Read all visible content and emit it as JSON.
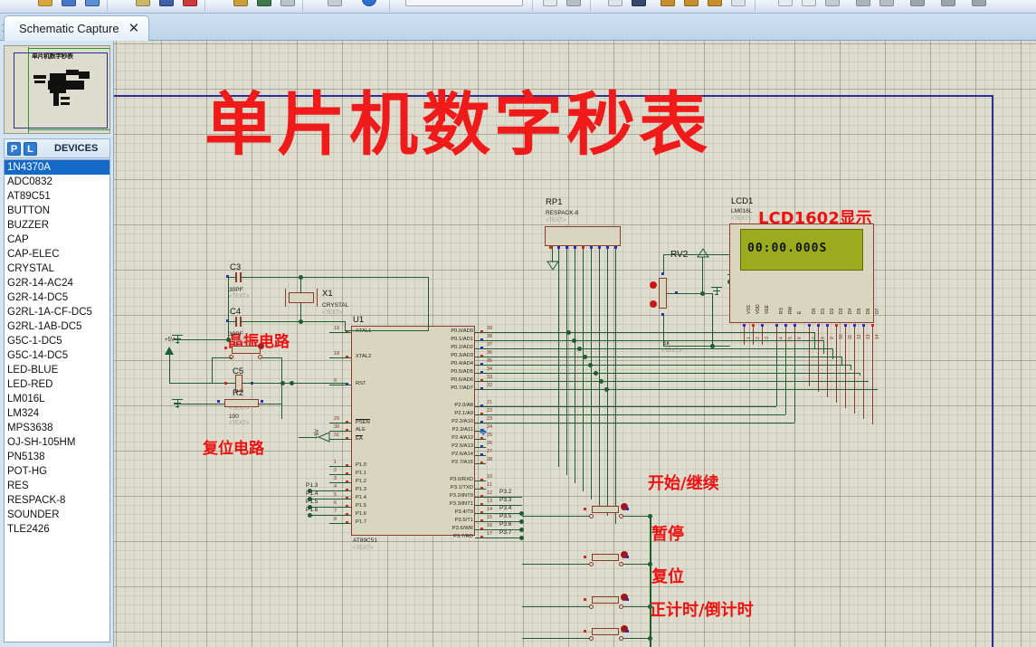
{
  "window": {
    "tab": {
      "label": "Schematic Capture",
      "close_icon": "close-icon",
      "add_icon": "add-tab-icon"
    }
  },
  "left_panel": {
    "navigator": {
      "thumb_title": "单片机数字秒表"
    },
    "devices_bar": {
      "btn_p": "P",
      "btn_l": "L",
      "label": "DEVICES"
    },
    "devices": [
      {
        "name": "1N4370A",
        "selected": true
      },
      {
        "name": "ADC0832",
        "selected": false
      },
      {
        "name": "AT89C51",
        "selected": false
      },
      {
        "name": "BUTTON",
        "selected": false
      },
      {
        "name": "BUZZER",
        "selected": false
      },
      {
        "name": "CAP",
        "selected": false
      },
      {
        "name": "CAP-ELEC",
        "selected": false
      },
      {
        "name": "CRYSTAL",
        "selected": false
      },
      {
        "name": "G2R-14-AC24",
        "selected": false
      },
      {
        "name": "G2R-14-DC5",
        "selected": false
      },
      {
        "name": "G2RL-1A-CF-DC5",
        "selected": false
      },
      {
        "name": "G2RL-1AB-DC5",
        "selected": false
      },
      {
        "name": "G5C-1-DC5",
        "selected": false
      },
      {
        "name": "G5C-14-DC5",
        "selected": false
      },
      {
        "name": "LED-BLUE",
        "selected": false
      },
      {
        "name": "LED-RED",
        "selected": false
      },
      {
        "name": "LM016L",
        "selected": false
      },
      {
        "name": "LM324",
        "selected": false
      },
      {
        "name": "MPS3638",
        "selected": false
      },
      {
        "name": "OJ-SH-105HM",
        "selected": false
      },
      {
        "name": "PN5138",
        "selected": false
      },
      {
        "name": "POT-HG",
        "selected": false
      },
      {
        "name": "RES",
        "selected": false
      },
      {
        "name": "RESPACK-8",
        "selected": false
      },
      {
        "name": "SOUNDER",
        "selected": false
      },
      {
        "name": "TLE2426",
        "selected": false
      }
    ]
  },
  "schematic": {
    "title": "单片机数字秒表",
    "annotations": {
      "lcd": "LCD1602显示",
      "crystal": "晶振电路",
      "reset": "复位电路",
      "btn_start": "开始/继续",
      "btn_pause": "暂停",
      "btn_reset": "复位",
      "btn_dir": "正计时/倒计时"
    },
    "lcd": {
      "ref": "LCD1",
      "value": "LM016L",
      "text_tag": "<TEXT>",
      "display": "00:00.000S",
      "pins": [
        "VSS",
        "VDD",
        "VEE",
        "RS",
        "RW",
        "E",
        "D0",
        "D1",
        "D2",
        "D3",
        "D4",
        "D5",
        "D6",
        "D7"
      ],
      "pin_numbers": [
        "1",
        "2",
        "3",
        "4",
        "5",
        "6",
        "7",
        "8",
        "9",
        "10",
        "11",
        "12",
        "13",
        "14"
      ]
    },
    "mcu": {
      "ref": "U1",
      "value": "AT89C51",
      "text_tag": "<TEXT>",
      "left_pins": [
        {
          "num": "19",
          "label": "XTAL1"
        },
        {
          "num": "18",
          "label": "XTAL2"
        },
        {
          "num": "9",
          "label": "RST"
        },
        {
          "num": "29",
          "label": "PSEN"
        },
        {
          "num": "30",
          "label": "ALE"
        },
        {
          "num": "31",
          "label": "EA"
        },
        {
          "num": "1",
          "label": "P1.0"
        },
        {
          "num": "2",
          "label": "P1.1"
        },
        {
          "num": "3",
          "label": "P1.2"
        },
        {
          "num": "4",
          "label": "P1.3"
        },
        {
          "num": "5",
          "label": "P1.4"
        },
        {
          "num": "6",
          "label": "P1.5"
        },
        {
          "num": "7",
          "label": "P1.6"
        },
        {
          "num": "8",
          "label": "P1.7"
        }
      ],
      "right_pins": [
        {
          "num": "39",
          "label": "P0.0/AD0"
        },
        {
          "num": "38",
          "label": "P0.1/AD1"
        },
        {
          "num": "37",
          "label": "P0.2/AD2"
        },
        {
          "num": "36",
          "label": "P0.3/AD3"
        },
        {
          "num": "35",
          "label": "P0.4/AD4"
        },
        {
          "num": "34",
          "label": "P0.5/AD5"
        },
        {
          "num": "33",
          "label": "P0.6/AD6"
        },
        {
          "num": "32",
          "label": "P0.7/AD7"
        },
        {
          "num": "21",
          "label": "P2.0/A8"
        },
        {
          "num": "22",
          "label": "P2.1/A9"
        },
        {
          "num": "23",
          "label": "P2.2/A10"
        },
        {
          "num": "24",
          "label": "P2.3/A11"
        },
        {
          "num": "25",
          "label": "P2.4/A12"
        },
        {
          "num": "26",
          "label": "P2.5/A13"
        },
        {
          "num": "27",
          "label": "P2.6/A14"
        },
        {
          "num": "28",
          "label": "P2.7/A15"
        },
        {
          "num": "10",
          "label": "P3.0/RXD"
        },
        {
          "num": "11",
          "label": "P3.1/TXD"
        },
        {
          "num": "12",
          "label": "P3.2/INT0"
        },
        {
          "num": "13",
          "label": "P3.3/INT1"
        },
        {
          "num": "14",
          "label": "P3.4/T0"
        },
        {
          "num": "15",
          "label": "P3.5/T1"
        },
        {
          "num": "16",
          "label": "P3.6/WR"
        },
        {
          "num": "17",
          "label": "P3.7/RD"
        }
      ],
      "net_labels_left": [
        "P1.3",
        "P1.4",
        "P1.5",
        "P1.6"
      ],
      "net_labels_right": [
        "P3.2",
        "P3.3",
        "P3.4",
        "P3.5",
        "P3.6",
        "P3.7"
      ]
    },
    "components": [
      {
        "ref": "C3",
        "value": "30PF",
        "text_tag": "<TEXT>"
      },
      {
        "ref": "C4",
        "value": "30PF",
        "text_tag": "<TEXT>"
      },
      {
        "ref": "X1",
        "value": "CRYSTAL",
        "text_tag": "<TEXT>"
      },
      {
        "ref": "C5",
        "value": "",
        "text_tag": "<TEXT>"
      },
      {
        "ref": "R2",
        "value": "100",
        "text_tag": "<TEXT>"
      },
      {
        "ref": "RP1",
        "value": "RESPACK-8",
        "text_tag": "<TEXT>"
      },
      {
        "ref": "RV2",
        "value": "1k",
        "text_tag": "<TEXT>"
      }
    ],
    "power_labels": [
      "+5V",
      "+5V"
    ],
    "colors": {
      "canvas": "#dedccd",
      "wire": "#1f5c32",
      "annotation_red": "#ee1111",
      "sheet_border": "#2d2d9e",
      "lcd_screen": "#9aab1e",
      "component_body": "#d8d6bf",
      "component_outline": "#8b3a2e"
    }
  }
}
